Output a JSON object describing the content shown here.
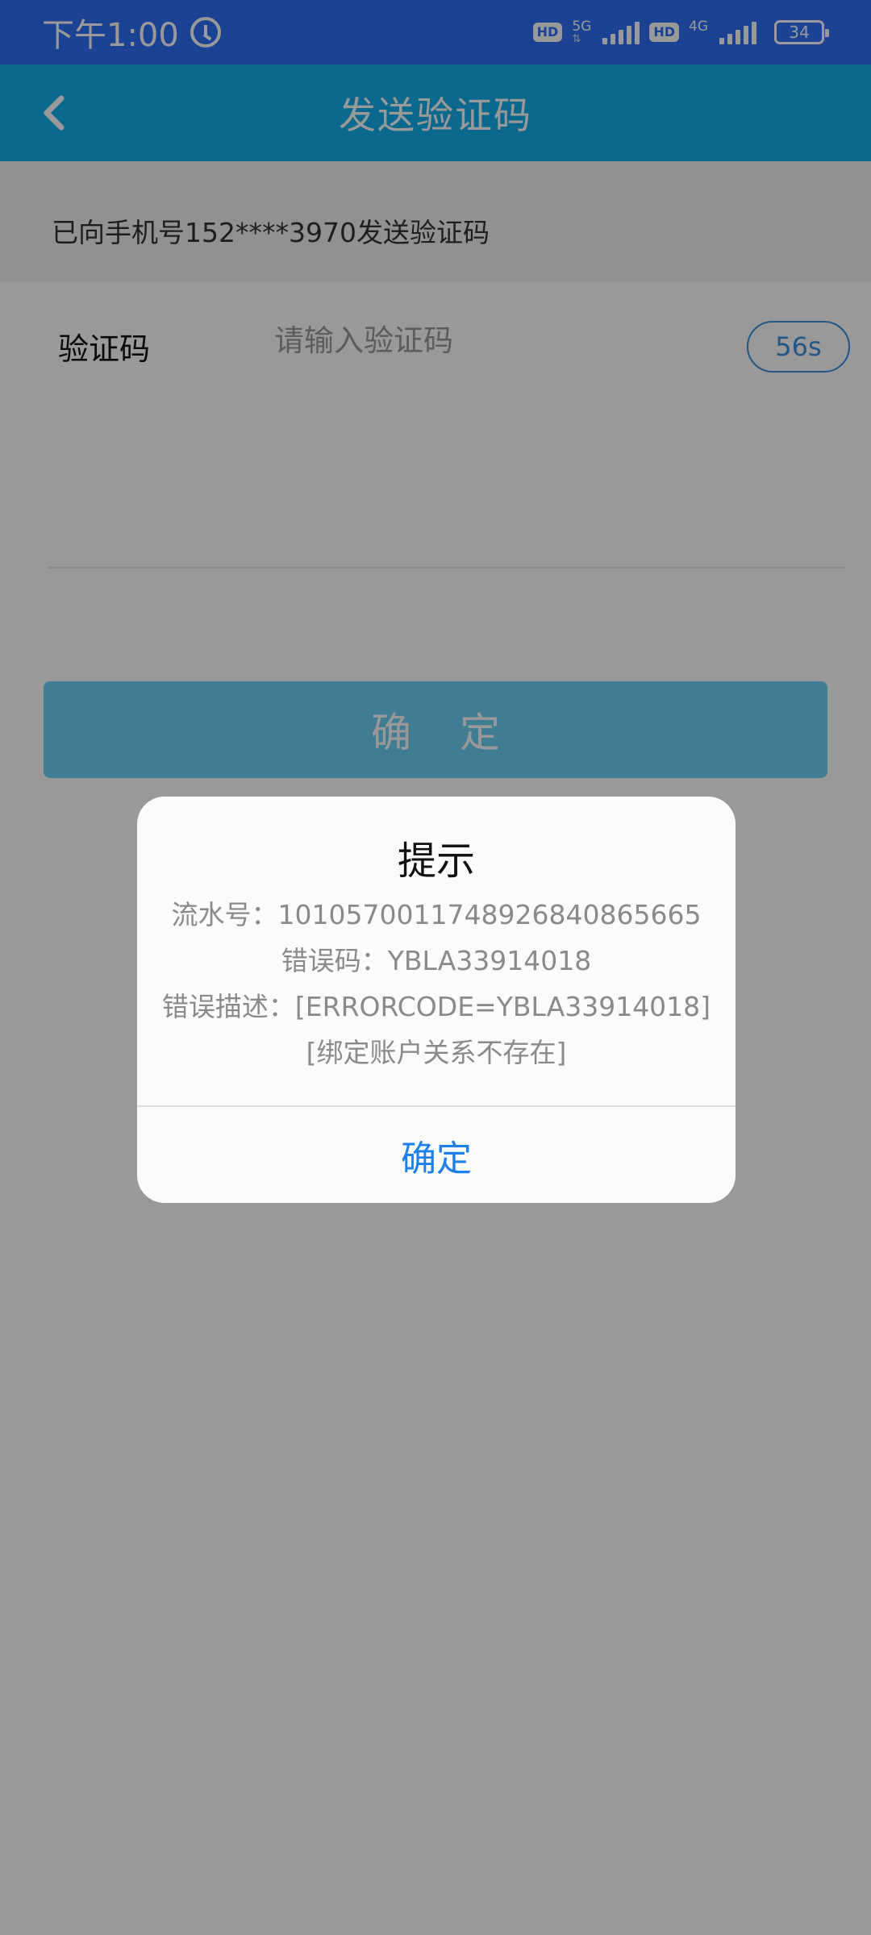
{
  "status_bar": {
    "time": "下午1:00",
    "hd_badge_1": "HD",
    "network_1": "5G",
    "hd_badge_2": "HD",
    "network_2": "4G",
    "battery": "34",
    "icons": [
      "alarm-icon",
      "signal-icon",
      "battery-icon"
    ]
  },
  "nav": {
    "title": "发送验证码",
    "back_icon": "chevron-left-icon"
  },
  "form": {
    "notice": "已向手机号152****3970发送验证码",
    "code_label": "验证码",
    "code_placeholder": "请输入验证码",
    "code_value": "",
    "countdown": "56s",
    "confirm_label": "确定"
  },
  "dialog": {
    "title": "提示",
    "lines": [
      "流水号：101057001174892684086566​5",
      "错误码：YBLA33914018",
      "错误描述：[ERRORCODE=YBLA33914018]",
      "[绑定账户关系不存在]"
    ],
    "confirm_label": "确定"
  },
  "colors": {
    "status_bar": "#2e6ff5",
    "nav_bar": "#12b0ea",
    "accent_blue": "#1d7fe8",
    "overlay": "rgba(0,0,0,0.40)"
  }
}
